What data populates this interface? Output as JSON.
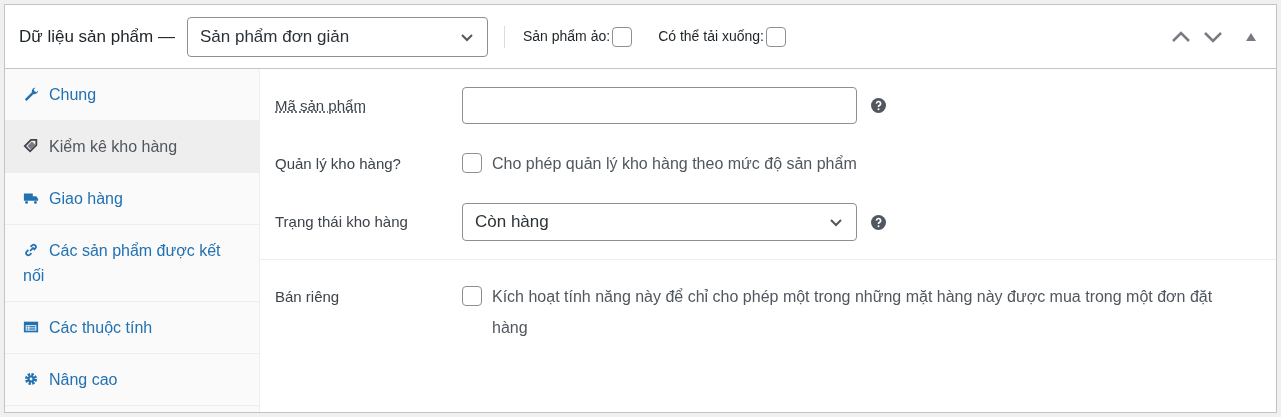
{
  "header": {
    "title": "Dữ liệu sản phẩm —",
    "product_type": "Sản phẩm đơn giản",
    "options": [
      {
        "label": "Sản phẩm ảo:",
        "checked": false
      },
      {
        "label": "Có thể tải xuống:",
        "checked": false
      }
    ]
  },
  "tabs": [
    {
      "label": "Chung",
      "selected": false
    },
    {
      "label": "Kiểm kê kho hàng",
      "selected": true
    },
    {
      "label": "Giao hàng",
      "selected": false
    },
    {
      "label": "Các sản phẩm được kết nối",
      "selected": false
    },
    {
      "label": "Các thuộc tính",
      "selected": false
    },
    {
      "label": "Nâng cao",
      "selected": false
    }
  ],
  "groups": [
    [
      {
        "kind": "text",
        "label": "Mã sản phẩm",
        "underlined": true,
        "help": true
      },
      {
        "kind": "checkbox",
        "label": "Quản lý kho hàng?",
        "underlined": false,
        "description": "Cho phép quản lý kho hàng theo mức độ sản phẩm",
        "checked": false,
        "help": false
      },
      {
        "kind": "select",
        "label": "Trạng thái kho hàng",
        "underlined": false,
        "value": "Còn hàng",
        "help": true
      }
    ],
    [
      {
        "kind": "checkbox",
        "label": "Bán riêng",
        "underlined": false,
        "description": "Kích hoạt tính năng này để chỉ cho phép một trong những mặt hàng này được mua trong một đơn đặt hàng",
        "checked": false,
        "help": false
      }
    ]
  ]
}
